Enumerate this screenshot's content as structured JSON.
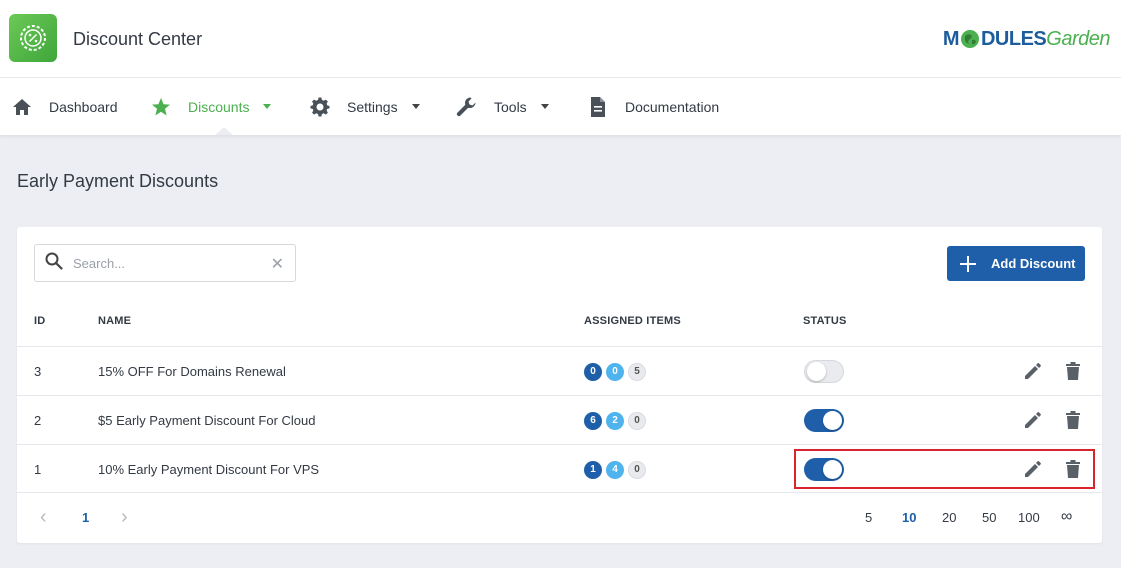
{
  "app": {
    "title": "Discount Center",
    "brand_part1": "M",
    "brand_part2": "DULES",
    "brand_part3": "Garden"
  },
  "nav": {
    "items": [
      {
        "label": "Dashboard",
        "icon": "home-icon"
      },
      {
        "label": "Discounts",
        "icon": "star-icon",
        "active": true,
        "dropdown": true
      },
      {
        "label": "Settings",
        "icon": "gear-icon",
        "dropdown": true
      },
      {
        "label": "Tools",
        "icon": "wrench-icon",
        "dropdown": true
      },
      {
        "label": "Documentation",
        "icon": "document-icon"
      }
    ]
  },
  "page": {
    "title": "Early Payment Discounts"
  },
  "search": {
    "placeholder": "Search..."
  },
  "toolbar": {
    "add_label": "Add Discount"
  },
  "table": {
    "headers": {
      "id": "ID",
      "name": "NAME",
      "assigned": "ASSIGNED ITEMS",
      "status": "STATUS"
    },
    "rows": [
      {
        "id": "3",
        "name": "15% OFF For Domains Renewal",
        "badges": [
          "0",
          "0",
          "5"
        ],
        "status": "off"
      },
      {
        "id": "2",
        "name": "$5 Early Payment Discount For Cloud",
        "badges": [
          "6",
          "2",
          "0"
        ],
        "status": "on"
      },
      {
        "id": "1",
        "name": "10% Early Payment Discount For VPS",
        "badges": [
          "1",
          "4",
          "0"
        ],
        "status": "on"
      }
    ]
  },
  "pagination": {
    "current_page": "1",
    "prev": "‹",
    "next": "›",
    "per_page": [
      "5",
      "10",
      "20",
      "50",
      "100",
      "∞"
    ],
    "selected_per_page": "10"
  },
  "colors": {
    "accent": "#4caf50",
    "primary": "#1f5fa9",
    "highlight": "#d9232d"
  }
}
